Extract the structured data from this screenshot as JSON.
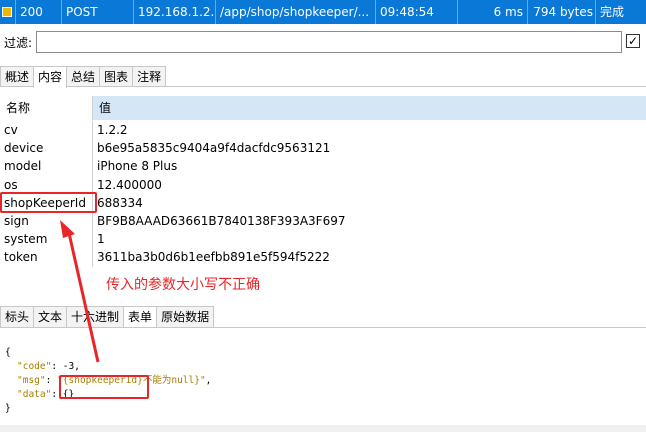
{
  "request": {
    "status": "200",
    "method": "POST",
    "host": "192.168.1.2...",
    "path": "/app/shop/shopkeeper/...",
    "time": "09:48:54",
    "duration": "6 ms",
    "size": "794 bytes",
    "state": "完成"
  },
  "filter": {
    "label": "过滤:",
    "value": "",
    "checkbox": "✓"
  },
  "tabs": [
    "概述",
    "内容",
    "总结",
    "图表",
    "注释"
  ],
  "table": {
    "headers": {
      "name": "名称",
      "value": "值"
    },
    "rows": [
      {
        "k": "cv",
        "v": "1.2.2"
      },
      {
        "k": "device",
        "v": "b6e95a5835c9404a9f4dacfdc9563121"
      },
      {
        "k": "model",
        "v": "iPhone 8 Plus"
      },
      {
        "k": "os",
        "v": "12.400000"
      },
      {
        "k": "shopKeeperId",
        "v": "688334"
      },
      {
        "k": "sign",
        "v": "BF9B8AAAD63661B7840138F393A3F697"
      },
      {
        "k": "system",
        "v": "1"
      },
      {
        "k": "token",
        "v": "3611ba3b0d6b1eefbb891e5f594f5222"
      }
    ]
  },
  "annotation": "传入的参数大小写不正确",
  "tabs2": [
    "标头",
    "文本",
    "十六进制",
    "表单",
    "原始数据"
  ],
  "json": {
    "open": "{",
    "code_key": "\"code\"",
    "code_val": "-3",
    "msg_key": "\"msg\"",
    "msg_val": "\"{shopkeeperId}不能为null}\"",
    "data_key": "\"data\"",
    "data_val": "{}",
    "close": "}"
  }
}
